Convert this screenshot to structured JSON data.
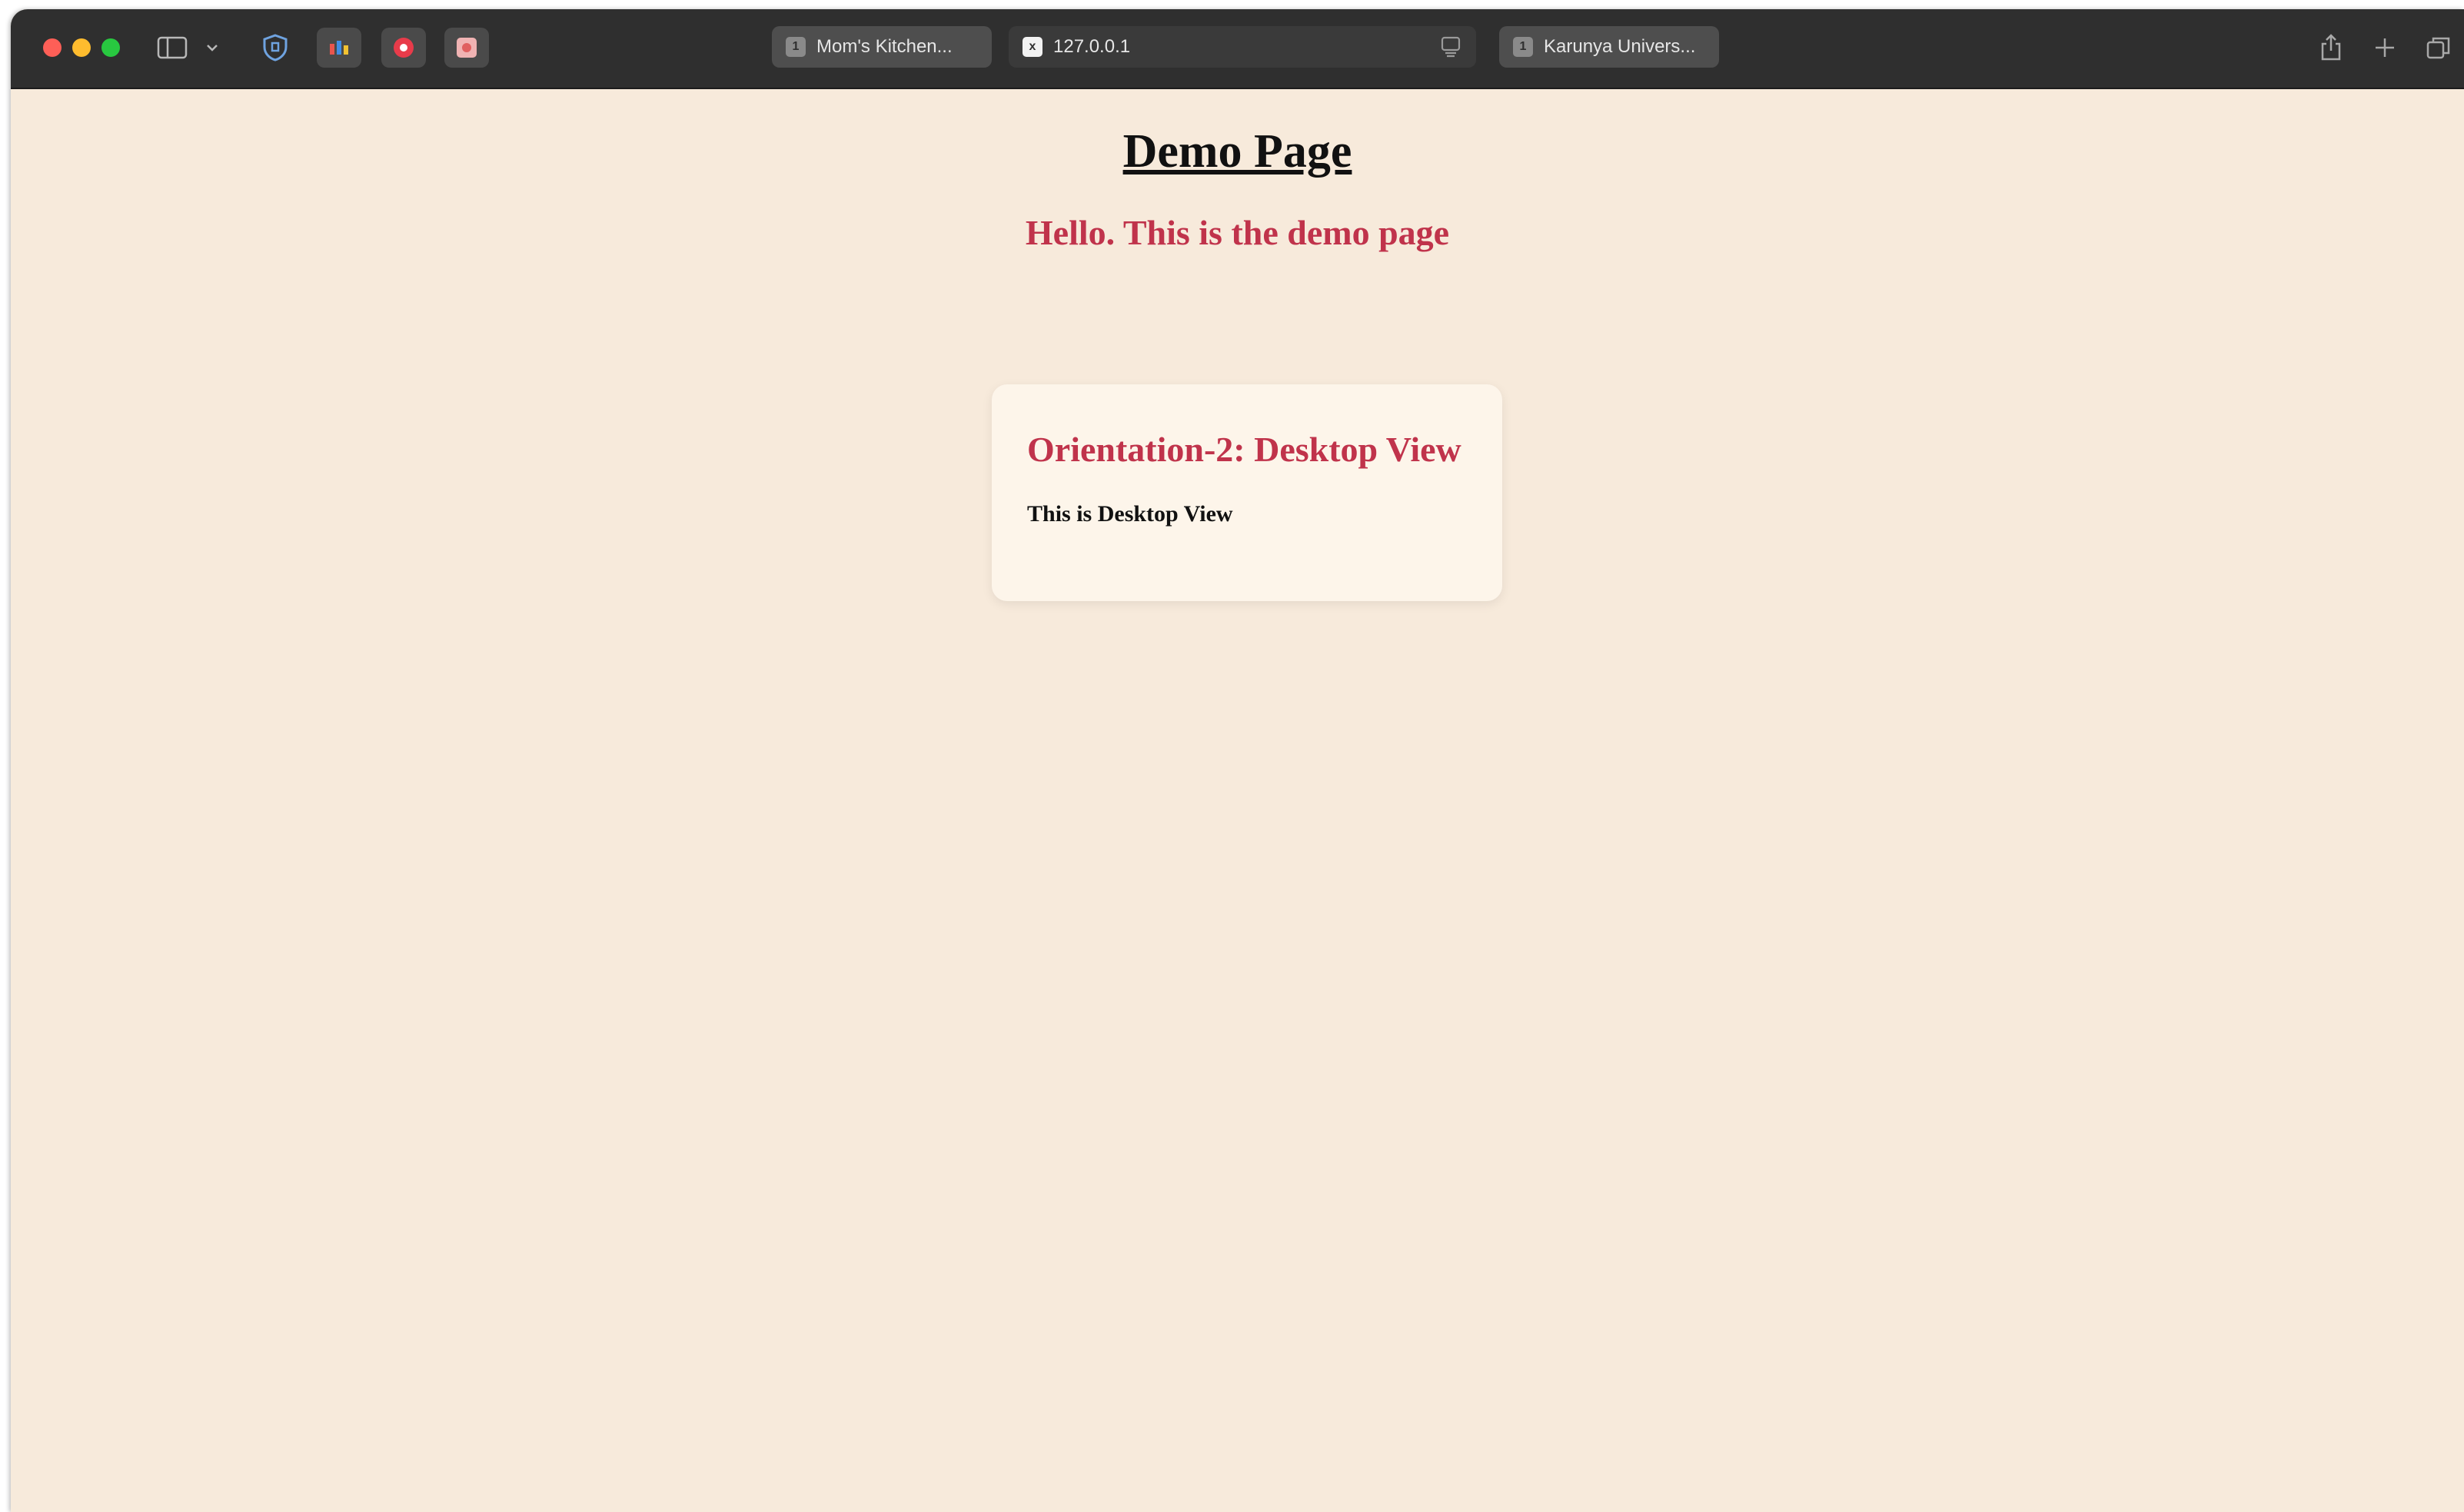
{
  "browser": {
    "tabs": [
      {
        "label": "Mom's Kitchen...",
        "favicon": "1"
      },
      {
        "label": "127.0.0.1",
        "favicon": "x"
      },
      {
        "label": "Karunya Univers...",
        "favicon": "1"
      }
    ],
    "icons": {
      "sidebar": "sidebar-icon",
      "shield": "shield-icon",
      "share": "share-icon",
      "new_tab": "plus-icon",
      "tab_overview": "tab-overview-icon",
      "reader": "reader-icon"
    },
    "colors": {
      "toolbar": "#2f2f2f",
      "close": "#fe5f57",
      "minimize": "#febc2e",
      "zoom": "#28c840"
    }
  },
  "page": {
    "title": "Demo Page",
    "subtitle": "Hello. This is the demo page",
    "card": {
      "title": "Orientation-2: Desktop View",
      "text": "This is Desktop View"
    },
    "colors": {
      "background": "#f7eadb",
      "card_background": "#fdf5ea",
      "accent": "#c0334b",
      "text": "#111111"
    }
  }
}
